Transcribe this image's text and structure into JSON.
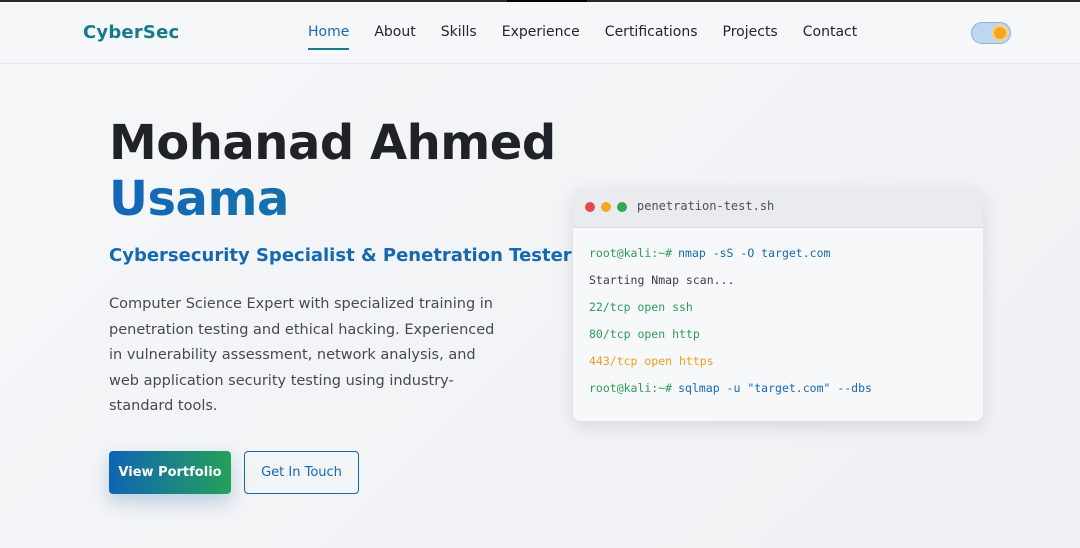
{
  "nav": {
    "logo": "CyberSec",
    "links": [
      "Home",
      "About",
      "Skills",
      "Experience",
      "Certifications",
      "Projects",
      "Contact"
    ],
    "active": "Home"
  },
  "hero": {
    "name_line1": "Mohanad Ahmed",
    "name_line2": "Usama",
    "subtitle": "Cybersecurity Specialist & Penetration Tester",
    "description": "Computer Science Expert with specialized training in penetration testing and ethical hacking. Experienced in vulnerability assessment, network analysis, and web application security testing using industry-standard tools.",
    "primary_button": "View Portfolio",
    "secondary_button": "Get In Touch"
  },
  "terminal": {
    "title": "penetration-test.sh",
    "prompt": "root@kali:~#",
    "cmd1": "nmap -sS -O target.com",
    "line2": "Starting Nmap scan...",
    "line3": "22/tcp open ssh",
    "line4": "80/tcp open http",
    "line5": "443/tcp open https",
    "cmd2": "sqlmap -u \"target.com\" --dbs"
  },
  "colors": {
    "brand": "#167a8a",
    "accent": "#1668b0",
    "success": "#2e9a5a",
    "warning": "#f29b1d"
  },
  "icons": {
    "theme_toggle": "sun-toggle-icon"
  }
}
